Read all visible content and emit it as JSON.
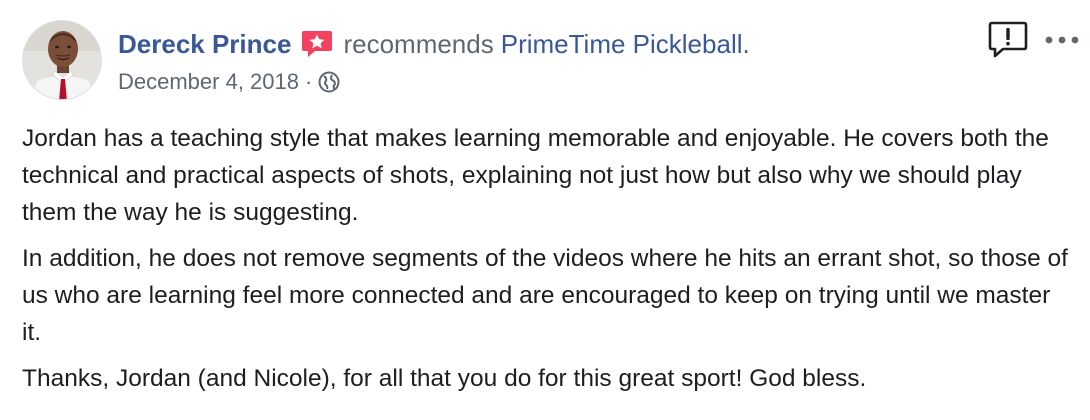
{
  "post": {
    "author": "Dereck Prince",
    "recommend_icon": "recommend-star-icon",
    "verb": "recommends",
    "page": "PrimeTime Pickleball.",
    "date": "December 4, 2018",
    "separator": "·",
    "privacy_icon": "globe-icon",
    "paragraphs": [
      "Jordan has a teaching style that makes learning memorable and enjoyable. He covers both the technical and practical aspects of shots, explaining not just how but also why we should play them the way he is suggesting.",
      "In addition, he does not remove segments of the videos where he hits an errant shot, so those of us who are learning feel more connected and are encouraged to keep on trying until we master it.",
      "Thanks, Jordan (and Nicole), for all that you do for this great sport! God bless."
    ]
  },
  "actions": {
    "report_icon": "report-icon",
    "more_icon": "more-options-icon"
  },
  "colors": {
    "link": "#385898",
    "secondary": "#606770",
    "text": "#1c1e21",
    "recommend": "#f3425f"
  }
}
